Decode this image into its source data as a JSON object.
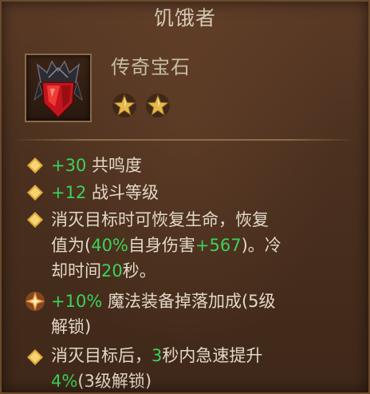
{
  "item": {
    "name": "饥饿者",
    "rarity": "传奇宝石",
    "star_count": 2,
    "icon": "legendary-gem-icon"
  },
  "colors": {
    "stat_value": "#3bd25a",
    "text": "#e2d8c8",
    "title": "#d6cbb8",
    "star": "#e6b84a"
  },
  "stats": [
    {
      "value": "+30",
      "label": " 共鸣度"
    },
    {
      "value": "+12",
      "label": " 战斗等级"
    }
  ],
  "effect": {
    "line1": "消灭目标时可恢复生命，恢复",
    "line2_a": "值为(",
    "line2_v1": "40%",
    "line2_b": "自身伤害",
    "line2_v2": "+567",
    "line2_c": ")。冷",
    "line3_a": "却时间",
    "line3_v": "20",
    "line3_b": "秒。"
  },
  "bonus": {
    "value": "+10%",
    "line1": " 魔法装备掉落加成(5级",
    "line2": "解锁)"
  },
  "haste": {
    "line1_a": "消灭目标后，",
    "line1_v": "3",
    "line1_b": "秒内急速提升",
    "line2_v": "4%",
    "line2_b": "(3级解锁)"
  }
}
